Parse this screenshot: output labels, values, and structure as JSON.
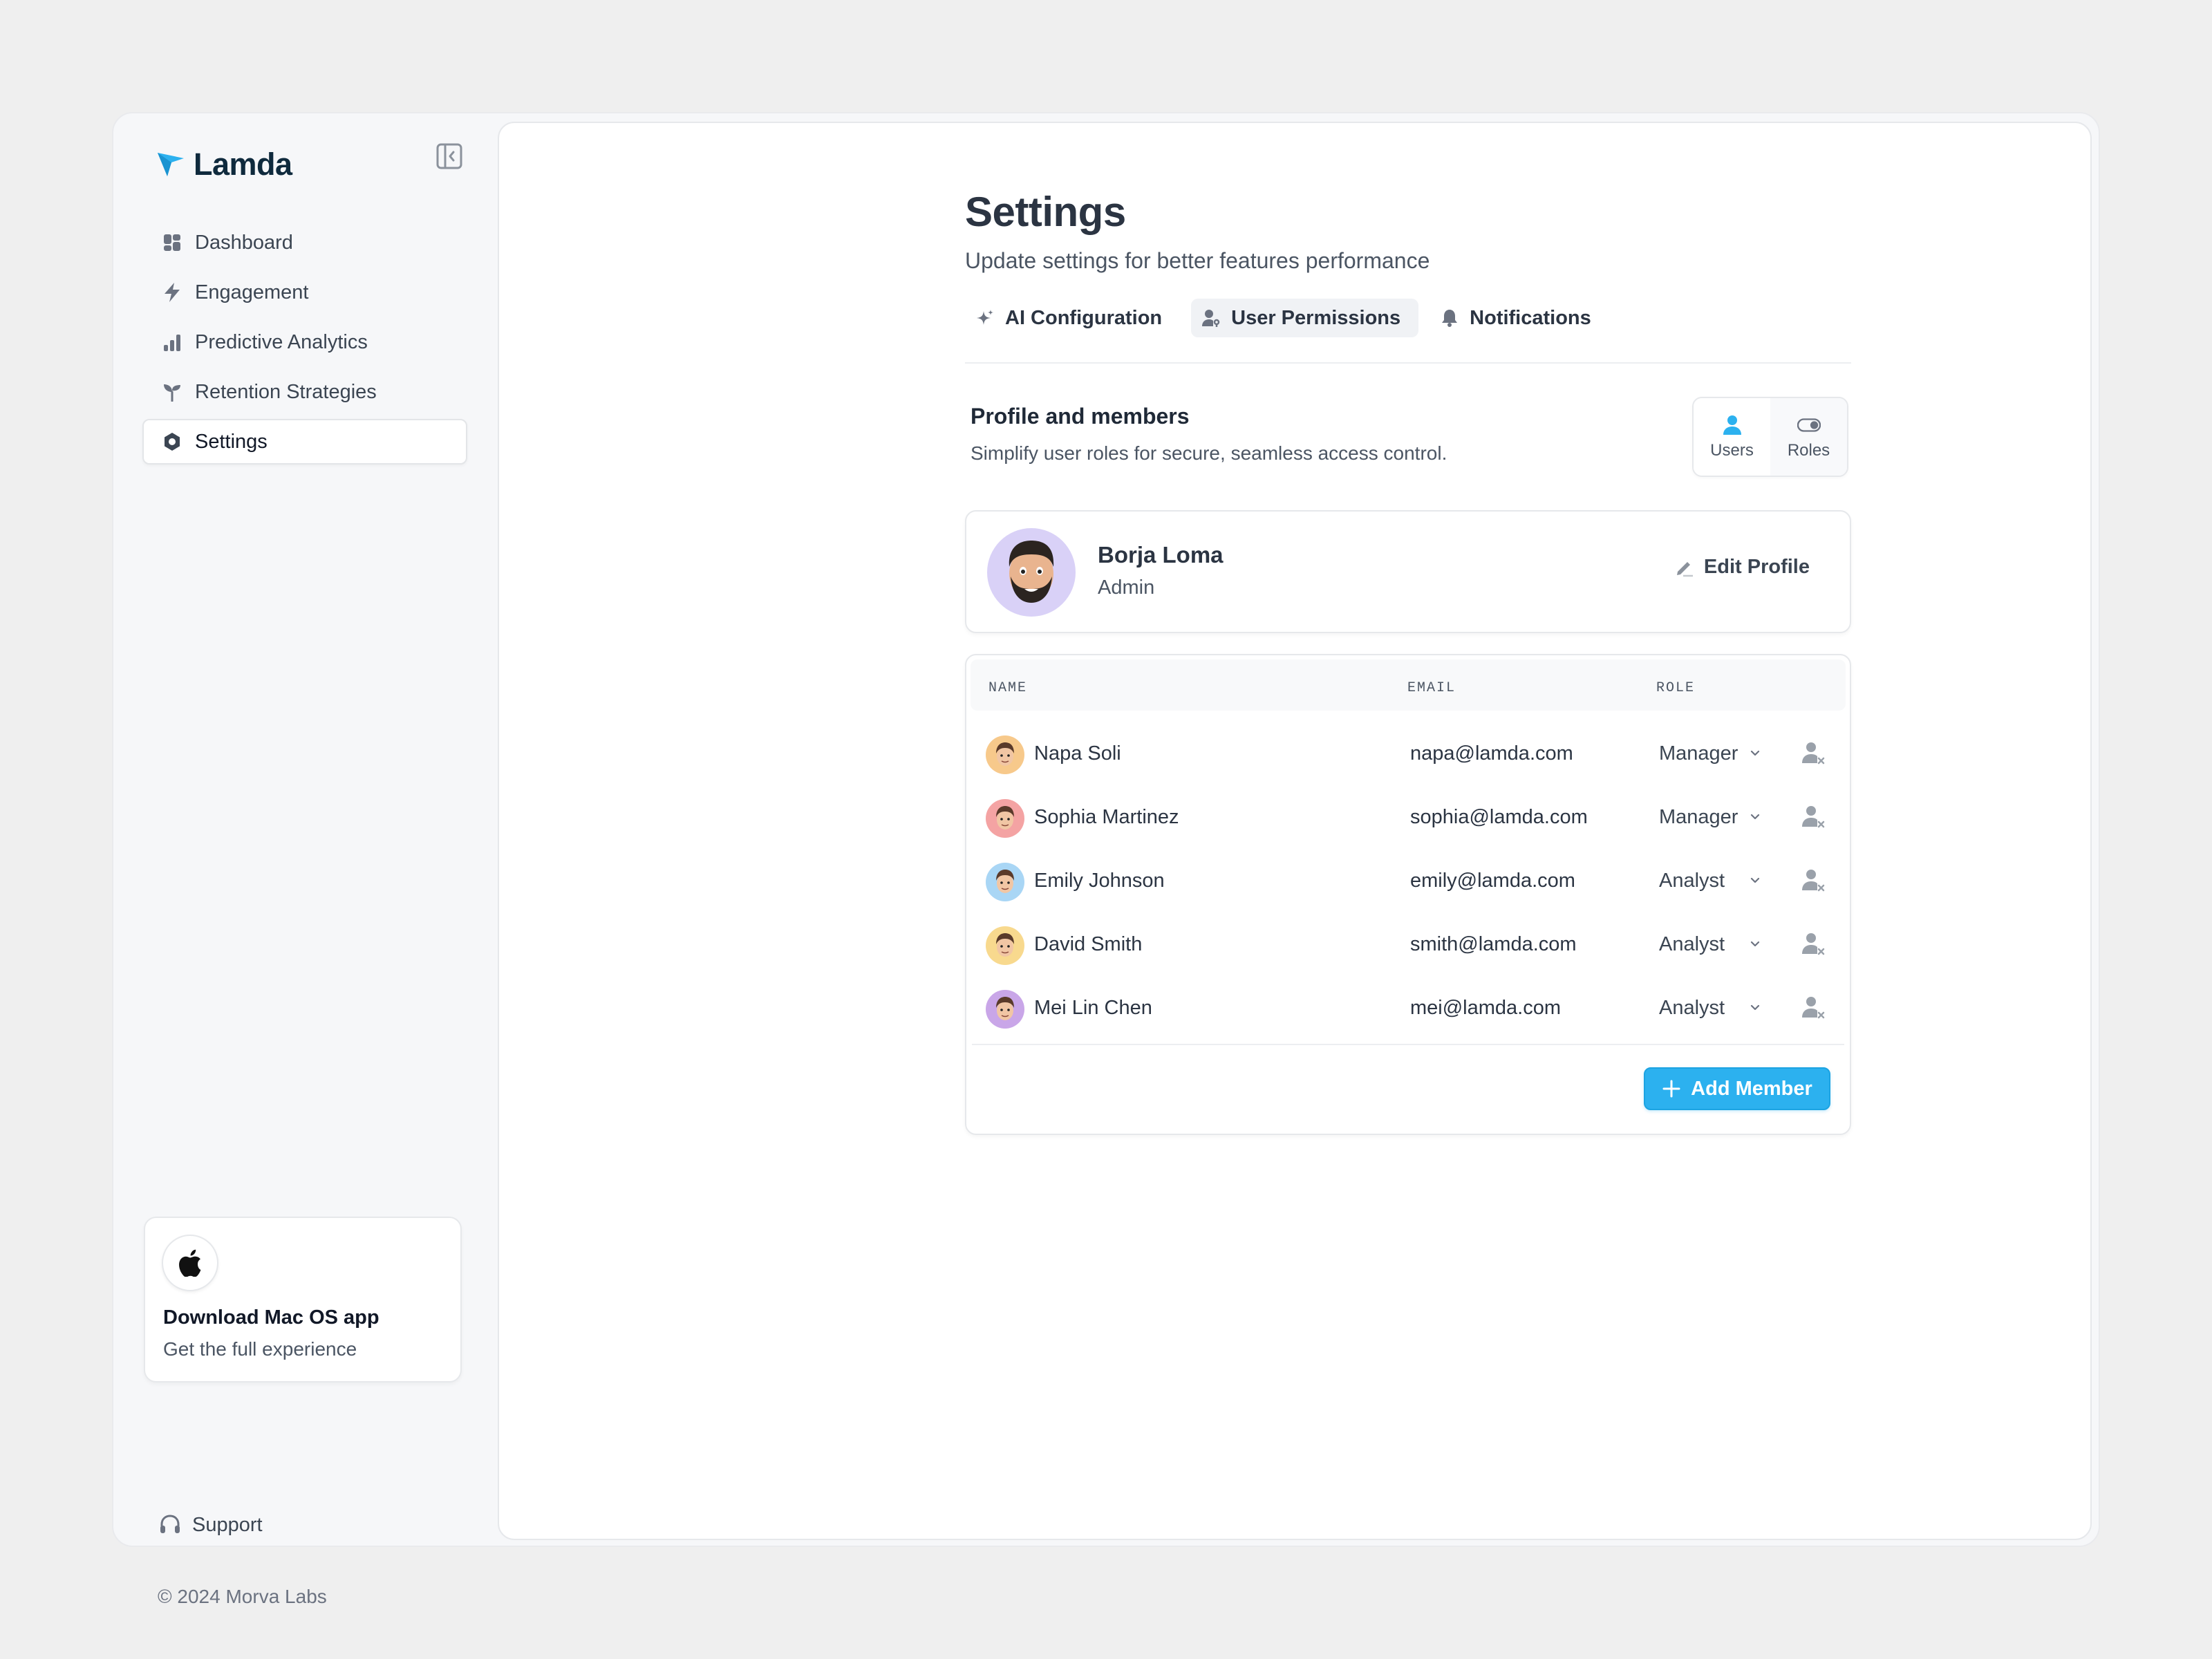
{
  "brand": {
    "name": "Lamda",
    "accent": "#2cb1ef"
  },
  "sidebar": {
    "items": [
      {
        "label": "Dashboard",
        "icon": "dashboard-icon"
      },
      {
        "label": "Engagement",
        "icon": "lightning-icon"
      },
      {
        "label": "Predictive Analytics",
        "icon": "bar-chart-icon"
      },
      {
        "label": "Retention Strategies",
        "icon": "sprout-icon"
      },
      {
        "label": "Settings",
        "icon": "gear-icon",
        "active": true
      }
    ],
    "promo": {
      "title": "Download Mac OS app",
      "subtitle": "Get the full experience",
      "icon": "apple-icon"
    },
    "support_label": "Support",
    "copyright": "© 2024 Morva Labs"
  },
  "page": {
    "title": "Settings",
    "subtitle": "Update settings for better features performance",
    "tabs": [
      {
        "label": "AI Configuration",
        "icon": "sparkle-icon"
      },
      {
        "label": "User Permissions",
        "icon": "user-key-icon",
        "active": true
      },
      {
        "label": "Notifications",
        "icon": "bell-icon"
      }
    ]
  },
  "section": {
    "title": "Profile and members",
    "subtitle": "Simplify user roles for secure, seamless access control.",
    "toggle": [
      {
        "label": "Users",
        "icon": "user-icon",
        "active": true
      },
      {
        "label": "Roles",
        "icon": "toggle-icon"
      }
    ]
  },
  "profile": {
    "name": "Borja Loma",
    "role": "Admin",
    "edit_label": "Edit Profile"
  },
  "table": {
    "headers": {
      "name": "NAME",
      "email": "EMAIL",
      "role": "ROLE"
    },
    "rows": [
      {
        "name": "Napa Soli",
        "email": "napa@lamda.com",
        "role": "Manager",
        "avatar_bg": "#f7c98b"
      },
      {
        "name": "Sophia Martinez",
        "email": "sophia@lamda.com",
        "role": "Manager",
        "avatar_bg": "#f4a3a3"
      },
      {
        "name": "Emily Johnson",
        "email": "emily@lamda.com",
        "role": "Analyst",
        "avatar_bg": "#a9d6f5"
      },
      {
        "name": "David Smith",
        "email": "smith@lamda.com",
        "role": "Analyst",
        "avatar_bg": "#f8d98e"
      },
      {
        "name": "Mei Lin Chen",
        "email": "mei@lamda.com",
        "role": "Analyst",
        "avatar_bg": "#c9a6e8"
      }
    ],
    "add_label": "Add Member"
  }
}
